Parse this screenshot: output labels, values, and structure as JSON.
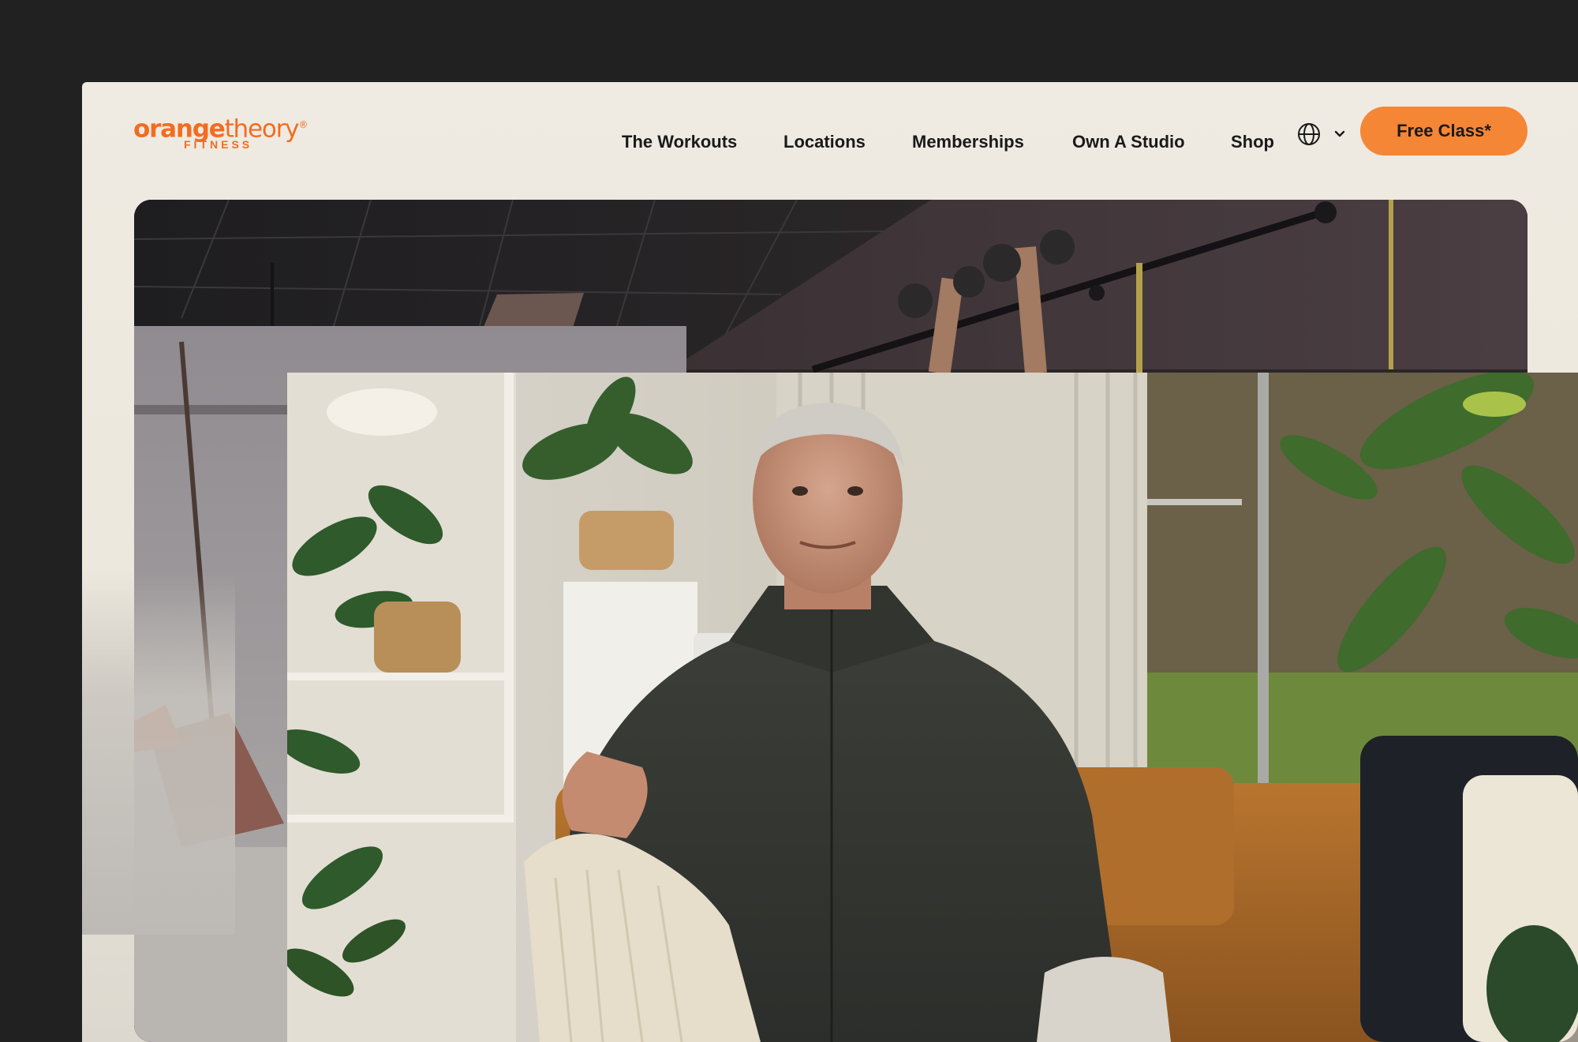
{
  "brand": {
    "name_bold": "orange",
    "name_light": "theory",
    "registered": "®",
    "subtitle": "FITNESS",
    "color": "#f36c21"
  },
  "nav": {
    "items": [
      {
        "label": "The Workouts"
      },
      {
        "label": "Locations"
      },
      {
        "label": "Memberships"
      },
      {
        "label": "Own A Studio"
      },
      {
        "label": "Shop"
      }
    ],
    "locale_icon": "globe-icon",
    "locale_chevron": "chevron-down-icon"
  },
  "cta": {
    "label": "Free Class*",
    "color": "#f58636"
  },
  "colors": {
    "page_background": "#212121",
    "header_background": "#efebe2"
  }
}
